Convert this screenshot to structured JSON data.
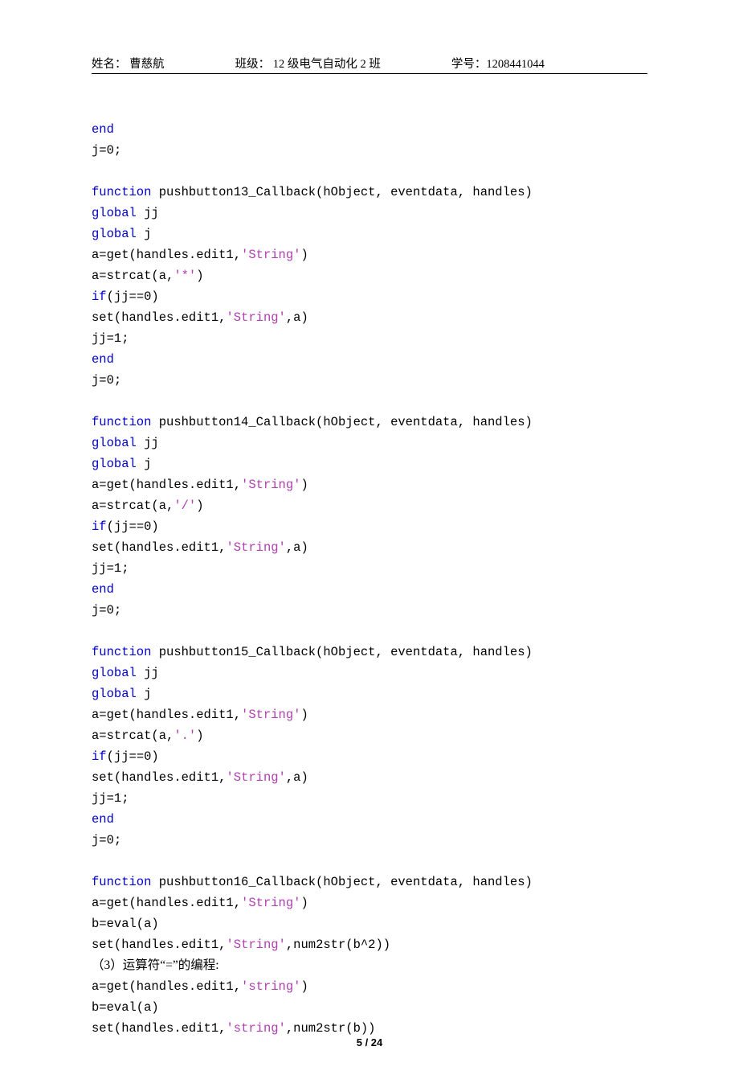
{
  "header": {
    "name_label": "姓名：",
    "name_value": "曹慈航",
    "class_label": "班级：",
    "class_value": "12 级电气自动化 2 班",
    "id_label": "学号：",
    "id_value": "1208441044"
  },
  "code": {
    "l01a": "end",
    "l02": "j=0;",
    "l03": "",
    "l04a": "function",
    "l04b": " pushbutton13_Callback(hObject, eventdata, handles)",
    "l05a": "global",
    "l05b": " jj",
    "l06a": "global",
    "l06b": " j",
    "l07a": "a=get(handles.edit1,",
    "l07b": "'String'",
    "l07c": ")",
    "l08a": "a=strcat(a,",
    "l08b": "'*'",
    "l08c": ")",
    "l09a": "if",
    "l09b": "(jj==0)",
    "l10a": "set(handles.edit1,",
    "l10b": "'String'",
    "l10c": ",a)",
    "l11": "jj=1;",
    "l12a": "end",
    "l13": "j=0;",
    "l14": "",
    "l15a": "function",
    "l15b": " pushbutton14_Callback(hObject, eventdata, handles)",
    "l16a": "global",
    "l16b": " jj",
    "l17a": "global",
    "l17b": " j",
    "l18a": "a=get(handles.edit1,",
    "l18b": "'String'",
    "l18c": ")",
    "l19a": "a=strcat(a,",
    "l19b": "'/'",
    "l19c": ")",
    "l20a": "if",
    "l20b": "(jj==0)",
    "l21a": "set(handles.edit1,",
    "l21b": "'String'",
    "l21c": ",a)",
    "l22": "jj=1;",
    "l23a": "end",
    "l24": "j=0;",
    "l25": "",
    "l26a": "function",
    "l26b": " pushbutton15_Callback(hObject, eventdata, handles)",
    "l27a": "global",
    "l27b": " jj",
    "l28a": "global",
    "l28b": " j",
    "l29a": "a=get(handles.edit1,",
    "l29b": "'String'",
    "l29c": ")",
    "l30a": "a=strcat(a,",
    "l30b": "'.'",
    "l30c": ")",
    "l31a": "if",
    "l31b": "(jj==0)",
    "l32a": "set(handles.edit1,",
    "l32b": "'String'",
    "l32c": ",a)",
    "l33": "jj=1;",
    "l34a": "end",
    "l35": "j=0;",
    "l36": "",
    "l37a": "function",
    "l37b": " pushbutton16_Callback(hObject, eventdata, handles)",
    "l38a": "a=get(handles.edit1,",
    "l38b": "'String'",
    "l38c": ")",
    "l39": "b=eval(a)",
    "l40a": "set(handles.edit1,",
    "l40b": "'String'",
    "l40c": ",num2str(b^2))",
    "l41": "（3）运算符“=”的编程:",
    "l42a": "a=get(handles.edit1,",
    "l42b": "'string'",
    "l42c": ")",
    "l43": "b=eval(a)",
    "l44a": "set(handles.edit1,",
    "l44b": "'string'",
    "l44c": ",num2str(b))"
  },
  "footer": {
    "page": "5 / 24"
  }
}
